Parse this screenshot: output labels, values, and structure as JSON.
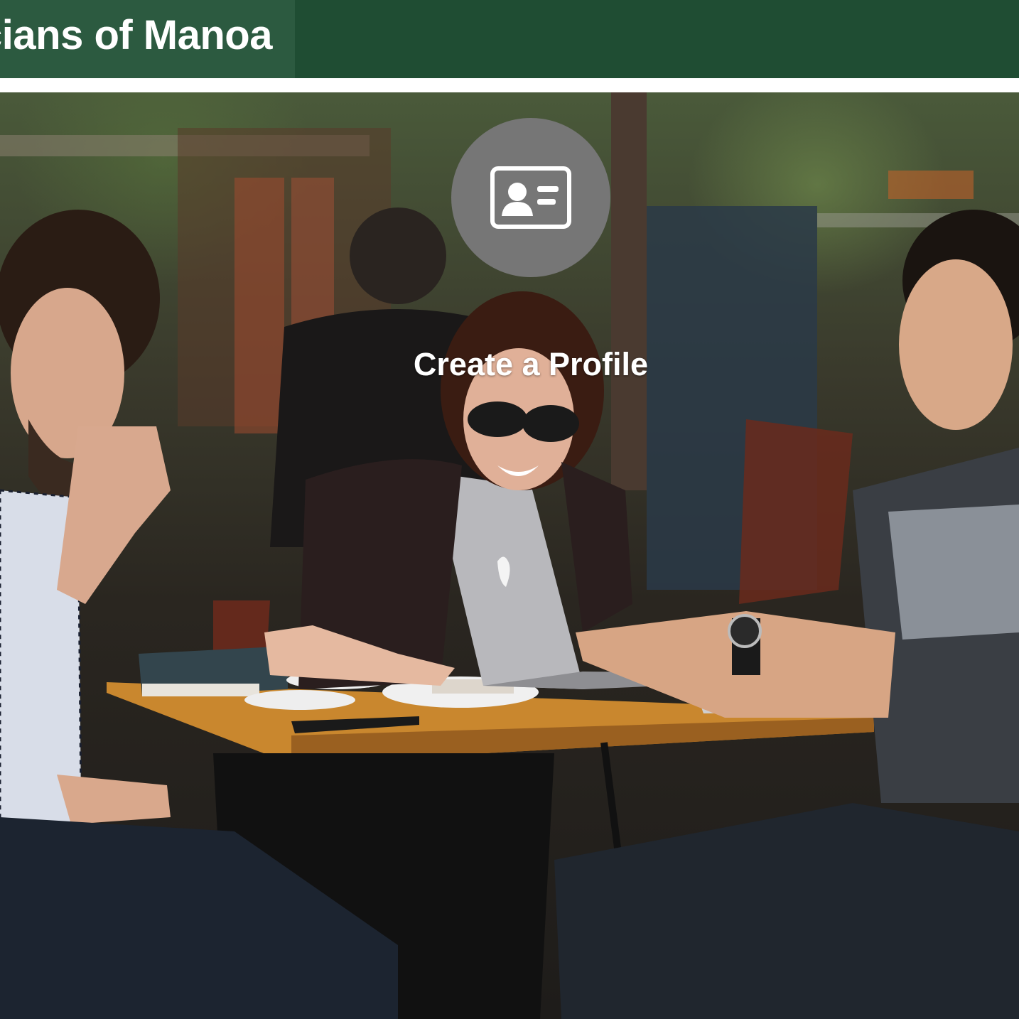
{
  "navbar": {
    "brand": "icians of Manoa",
    "background_color": "#1f4d33",
    "brand_background_color": "#2c5a40"
  },
  "hero": {
    "title": "Create a Profile",
    "icon": "id-card-icon",
    "icon_circle_color": "#767676",
    "background_image": "photo of three people sitting at an outdoor cafe table with a laptop"
  }
}
